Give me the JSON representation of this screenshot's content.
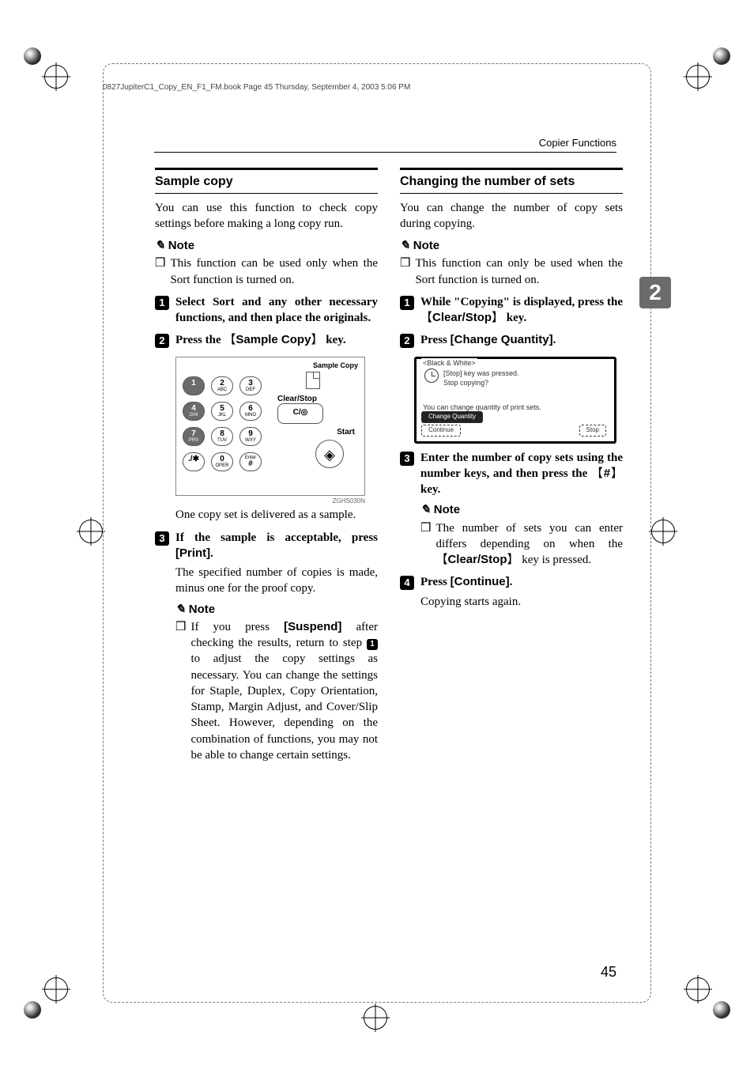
{
  "header_line": "0827JupiterC1_Copy_EN_F1_FM.book  Page 45  Thursday, September 4, 2003  5:06 PM",
  "running_head": "Copier Functions",
  "chapter_tab": "2",
  "page_number": "45",
  "left": {
    "title": "Sample copy",
    "lead": "You can use this function to check copy settings before making a long copy run.",
    "note_label": "Note",
    "note_item": "This function can be used only when the Sort function is turned on.",
    "step1": "Select Sort and any other necessary functions, and then place the originals.",
    "step2_pre": "Press the ",
    "step2_key": "Sample Copy",
    "step2_post": " key.",
    "keypad": {
      "title": "Sample Copy",
      "keys": {
        "k1": "1",
        "k2": "2",
        "k2s": "ABC",
        "k3": "3",
        "k3s": "DEF",
        "k4": "4",
        "k4s": "GHI",
        "k5": "5",
        "k5s": "JKL",
        "k6": "6",
        "k6s": "MNO",
        "k7": "7",
        "k7s": "PRS",
        "k8": "8",
        "k8s": "TUV",
        "k9": "9",
        "k9s": "WXY",
        "kstar": "./✱",
        "k0": "0",
        "k0s": "OPER",
        "kenter": "Enter",
        "khash": "#"
      },
      "clear_stop": "Clear/Stop",
      "clear_sym": "C/◎",
      "start": "Start",
      "caption": "ZGHS030N"
    },
    "after_fig": "One copy set is delivered as a sample.",
    "step3_pre": "If the sample is acceptable, press ",
    "step3_key": "[Print]",
    "step3_post": ".",
    "after_step3": "The specified number of copies is made, minus one for the proof copy.",
    "note2_label": "Note",
    "note2_pre": "If you press ",
    "note2_key": "[Suspend]",
    "note2_mid1": " after checking the results, return to step ",
    "note2_stepref": "1",
    "note2_post": " to adjust the copy settings as necessary. You can change the settings for Staple, Duplex, Copy Orientation, Stamp, Margin Adjust, and Cover/Slip Sheet. However, depending on the combination of functions, you may not be able to change certain settings."
  },
  "right": {
    "title": "Changing the number of sets",
    "lead": "You can change the number of copy sets during copying.",
    "note_label": "Note",
    "note_item": "This function can only be used when the Sort function is turned on.",
    "step1_pre": "While \"Copying\" is displayed, press the ",
    "step1_key": "Clear/Stop",
    "step1_post": " key.",
    "step2_pre": "Press ",
    "step2_key": "[Change Quantity]",
    "step2_post": ".",
    "lcd": {
      "tab": "<Black & White>",
      "msg1": "[Stop] key was pressed.",
      "msg2": "Stop copying?",
      "line2": "You can change quantity of print sets.",
      "btn_change": "Change Quantity",
      "btn_continue": "Continue",
      "btn_stop": "Stop"
    },
    "step3_pre": "Enter the number of copy sets using the number keys, and then press the ",
    "step3_key": "#",
    "step3_post": " key.",
    "note2_label": "Note",
    "note2_pre": "The number of sets you can enter differs depending on when the ",
    "note2_key": "Clear/Stop",
    "note2_post": " key is pressed.",
    "step4_pre": "Press ",
    "step4_key": "[Continue]",
    "step4_post": ".",
    "after_step4": "Copying starts again."
  }
}
